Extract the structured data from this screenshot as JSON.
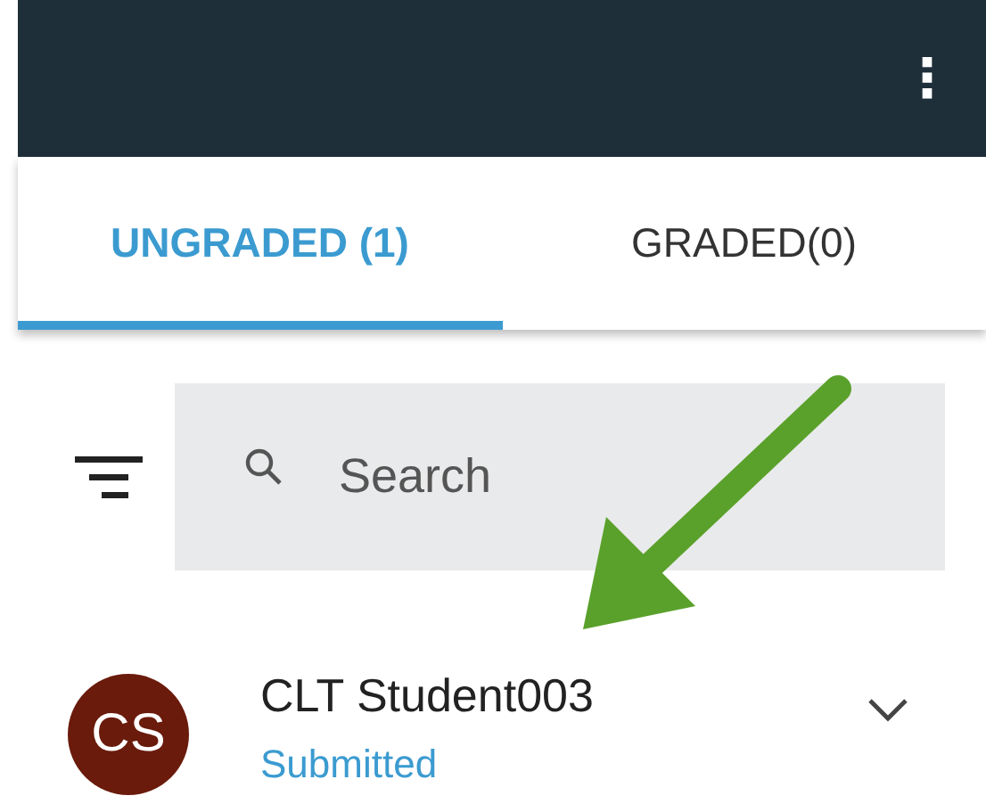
{
  "app_bar": {
    "menu_icon": "⋮"
  },
  "tabs": [
    {
      "label": "UNGRADED (1)",
      "selected": true
    },
    {
      "label": "GRADED(0)",
      "selected": false
    }
  ],
  "search": {
    "placeholder": "Search"
  },
  "students": [
    {
      "initials": "CS",
      "name": "CLT Student003",
      "status": "Submitted",
      "color": "#6a1b0c",
      "expanded": false
    }
  ]
}
